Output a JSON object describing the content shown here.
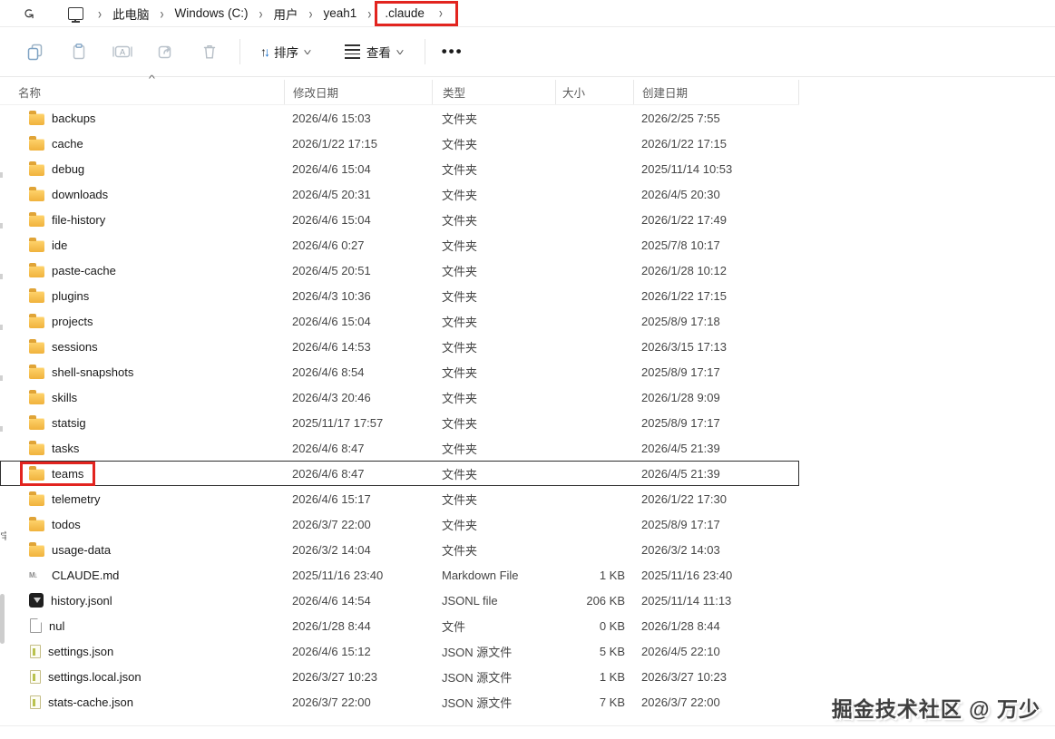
{
  "breadcrumb": {
    "segments": [
      "此电脑",
      "Windows (C:)",
      "用户",
      "yeah1",
      ".claude"
    ]
  },
  "toolbar": {
    "sort_label": "排序",
    "view_label": "查看",
    "more_label": "…",
    "icons": [
      "copy-icon",
      "paste-icon",
      "rename-icon",
      "share-icon",
      "delete-icon"
    ]
  },
  "table": {
    "columns": [
      "名称",
      "修改日期",
      "类型",
      "大小",
      "创建日期"
    ],
    "sort_indicator": "^",
    "rows": [
      {
        "name": "backups",
        "icon": "folder",
        "modified": "2026/4/6 15:03",
        "type": "文件夹",
        "size": "",
        "created": "2026/2/25 7:55"
      },
      {
        "name": "cache",
        "icon": "folder",
        "modified": "2026/1/22 17:15",
        "type": "文件夹",
        "size": "",
        "created": "2026/1/22 17:15"
      },
      {
        "name": "debug",
        "icon": "folder",
        "modified": "2026/4/6 15:04",
        "type": "文件夹",
        "size": "",
        "created": "2025/11/14 10:53"
      },
      {
        "name": "downloads",
        "icon": "folder",
        "modified": "2026/4/5 20:31",
        "type": "文件夹",
        "size": "",
        "created": "2026/4/5 20:30"
      },
      {
        "name": "file-history",
        "icon": "folder",
        "modified": "2026/4/6 15:04",
        "type": "文件夹",
        "size": "",
        "created": "2026/1/22 17:49"
      },
      {
        "name": "ide",
        "icon": "folder",
        "modified": "2026/4/6 0:27",
        "type": "文件夹",
        "size": "",
        "created": "2025/7/8 10:17"
      },
      {
        "name": "paste-cache",
        "icon": "folder",
        "modified": "2026/4/5 20:51",
        "type": "文件夹",
        "size": "",
        "created": "2026/1/28 10:12"
      },
      {
        "name": "plugins",
        "icon": "folder",
        "modified": "2026/4/3 10:36",
        "type": "文件夹",
        "size": "",
        "created": "2026/1/22 17:15"
      },
      {
        "name": "projects",
        "icon": "folder",
        "modified": "2026/4/6 15:04",
        "type": "文件夹",
        "size": "",
        "created": "2025/8/9 17:18"
      },
      {
        "name": "sessions",
        "icon": "folder",
        "modified": "2026/4/6 14:53",
        "type": "文件夹",
        "size": "",
        "created": "2026/3/15 17:13"
      },
      {
        "name": "shell-snapshots",
        "icon": "folder",
        "modified": "2026/4/6 8:54",
        "type": "文件夹",
        "size": "",
        "created": "2025/8/9 17:17"
      },
      {
        "name": "skills",
        "icon": "folder",
        "modified": "2026/4/3 20:46",
        "type": "文件夹",
        "size": "",
        "created": "2026/1/28 9:09"
      },
      {
        "name": "statsig",
        "icon": "folder",
        "modified": "2025/11/17 17:57",
        "type": "文件夹",
        "size": "",
        "created": "2025/8/9 17:17"
      },
      {
        "name": "tasks",
        "icon": "folder",
        "modified": "2026/4/6 8:47",
        "type": "文件夹",
        "size": "",
        "created": "2026/4/5 21:39"
      },
      {
        "name": "teams",
        "icon": "folder",
        "modified": "2026/4/6 8:47",
        "type": "文件夹",
        "size": "",
        "created": "2026/4/5 21:39",
        "selected": true,
        "annotated": true
      },
      {
        "name": "telemetry",
        "icon": "folder",
        "modified": "2026/4/6 15:17",
        "type": "文件夹",
        "size": "",
        "created": "2026/1/22 17:30"
      },
      {
        "name": "todos",
        "icon": "folder",
        "modified": "2026/3/7 22:00",
        "type": "文件夹",
        "size": "",
        "created": "2025/8/9 17:17"
      },
      {
        "name": "usage-data",
        "icon": "folder",
        "modified": "2026/3/2 14:04",
        "type": "文件夹",
        "size": "",
        "created": "2026/3/2 14:03"
      },
      {
        "name": "CLAUDE.md",
        "icon": "markdown",
        "modified": "2025/11/16 23:40",
        "type": "Markdown File",
        "size": "1 KB",
        "created": "2025/11/16 23:40"
      },
      {
        "name": "history.jsonl",
        "icon": "jsonl",
        "modified": "2026/4/6 14:54",
        "type": "JSONL file",
        "size": "206 KB",
        "created": "2025/11/14 11:13"
      },
      {
        "name": "nul",
        "icon": "file",
        "modified": "2026/1/28 8:44",
        "type": "文件",
        "size": "0 KB",
        "created": "2026/1/28 8:44"
      },
      {
        "name": "settings.json",
        "icon": "json",
        "modified": "2026/4/6 15:12",
        "type": "JSON 源文件",
        "size": "5 KB",
        "created": "2026/4/5 22:10"
      },
      {
        "name": "settings.local.json",
        "icon": "json",
        "modified": "2026/3/27 10:23",
        "type": "JSON 源文件",
        "size": "1 KB",
        "created": "2026/3/27 10:23"
      },
      {
        "name": "stats-cache.json",
        "icon": "json",
        "modified": "2026/3/7 22:00",
        "type": "JSON 源文件",
        "size": "7 KB",
        "created": "2026/3/7 22:00"
      }
    ]
  },
  "watermark": "掘金技术社区 @ 万少",
  "colors": {
    "annotation_red": "#e2241f",
    "selection_outline": "#2e2e2e",
    "sort_arrow_blue": "#0b69cb",
    "folder_yellow": "#f3b73e"
  }
}
